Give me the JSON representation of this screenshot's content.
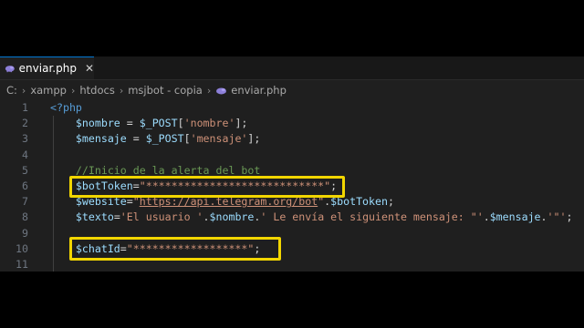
{
  "tab": {
    "label": "enviar.php",
    "close": "✕"
  },
  "breadcrumb": [
    "C:",
    "xampp",
    "htdocs",
    "msjbot - copia",
    "enviar.php"
  ],
  "lines": [
    {
      "n": "1",
      "tokens": [
        [
          "kw",
          "<?php"
        ]
      ]
    },
    {
      "n": "2",
      "tokens": [
        [
          "var",
          "    $nombre"
        ],
        [
          "op",
          " = "
        ],
        [
          "var",
          "$_POST"
        ],
        [
          "op",
          "["
        ],
        [
          "str",
          "'nombre'"
        ],
        [
          "op",
          "];"
        ]
      ]
    },
    {
      "n": "3",
      "tokens": [
        [
          "var",
          "    $mensaje"
        ],
        [
          "op",
          " = "
        ],
        [
          "var",
          "$_POST"
        ],
        [
          "op",
          "["
        ],
        [
          "str",
          "'mensaje'"
        ],
        [
          "op",
          "];"
        ]
      ]
    },
    {
      "n": "4",
      "tokens": []
    },
    {
      "n": "5",
      "tokens": [
        [
          "cmt",
          "    //Inicio de la alerta del bot"
        ]
      ]
    },
    {
      "n": "6",
      "tokens": [
        [
          "var",
          "    $botToken"
        ],
        [
          "op",
          "="
        ],
        [
          "str",
          "\"****************************\""
        ],
        [
          "op",
          ";"
        ]
      ]
    },
    {
      "n": "7",
      "tokens": [
        [
          "var",
          "    $website"
        ],
        [
          "op",
          "="
        ],
        [
          "str",
          "\""
        ],
        [
          "url",
          "https://api.telegram.org/bot"
        ],
        [
          "str",
          "\""
        ],
        [
          "op",
          "."
        ],
        [
          "var",
          "$botToken"
        ],
        [
          "op",
          ";"
        ]
      ]
    },
    {
      "n": "8",
      "tokens": [
        [
          "var",
          "    $texto"
        ],
        [
          "op",
          "="
        ],
        [
          "str",
          "'El usuario '"
        ],
        [
          "op",
          "."
        ],
        [
          "var",
          "$nombre"
        ],
        [
          "op",
          "."
        ],
        [
          "str",
          "' Le envía el siguiente mensaje: \"'"
        ],
        [
          "op",
          "."
        ],
        [
          "var",
          "$mensaje"
        ],
        [
          "op",
          "."
        ],
        [
          "str",
          "'\"'"
        ],
        [
          "op",
          ";"
        ]
      ]
    },
    {
      "n": "9",
      "tokens": []
    },
    {
      "n": "10",
      "tokens": [
        [
          "var",
          "    $chatId"
        ],
        [
          "op",
          "="
        ],
        [
          "str",
          "\"******************\""
        ],
        [
          "op",
          ";"
        ]
      ]
    },
    {
      "n": "11",
      "tokens": []
    }
  ],
  "colors": {
    "highlight": "#f2d600",
    "php_icon": "#8c7fd8"
  }
}
